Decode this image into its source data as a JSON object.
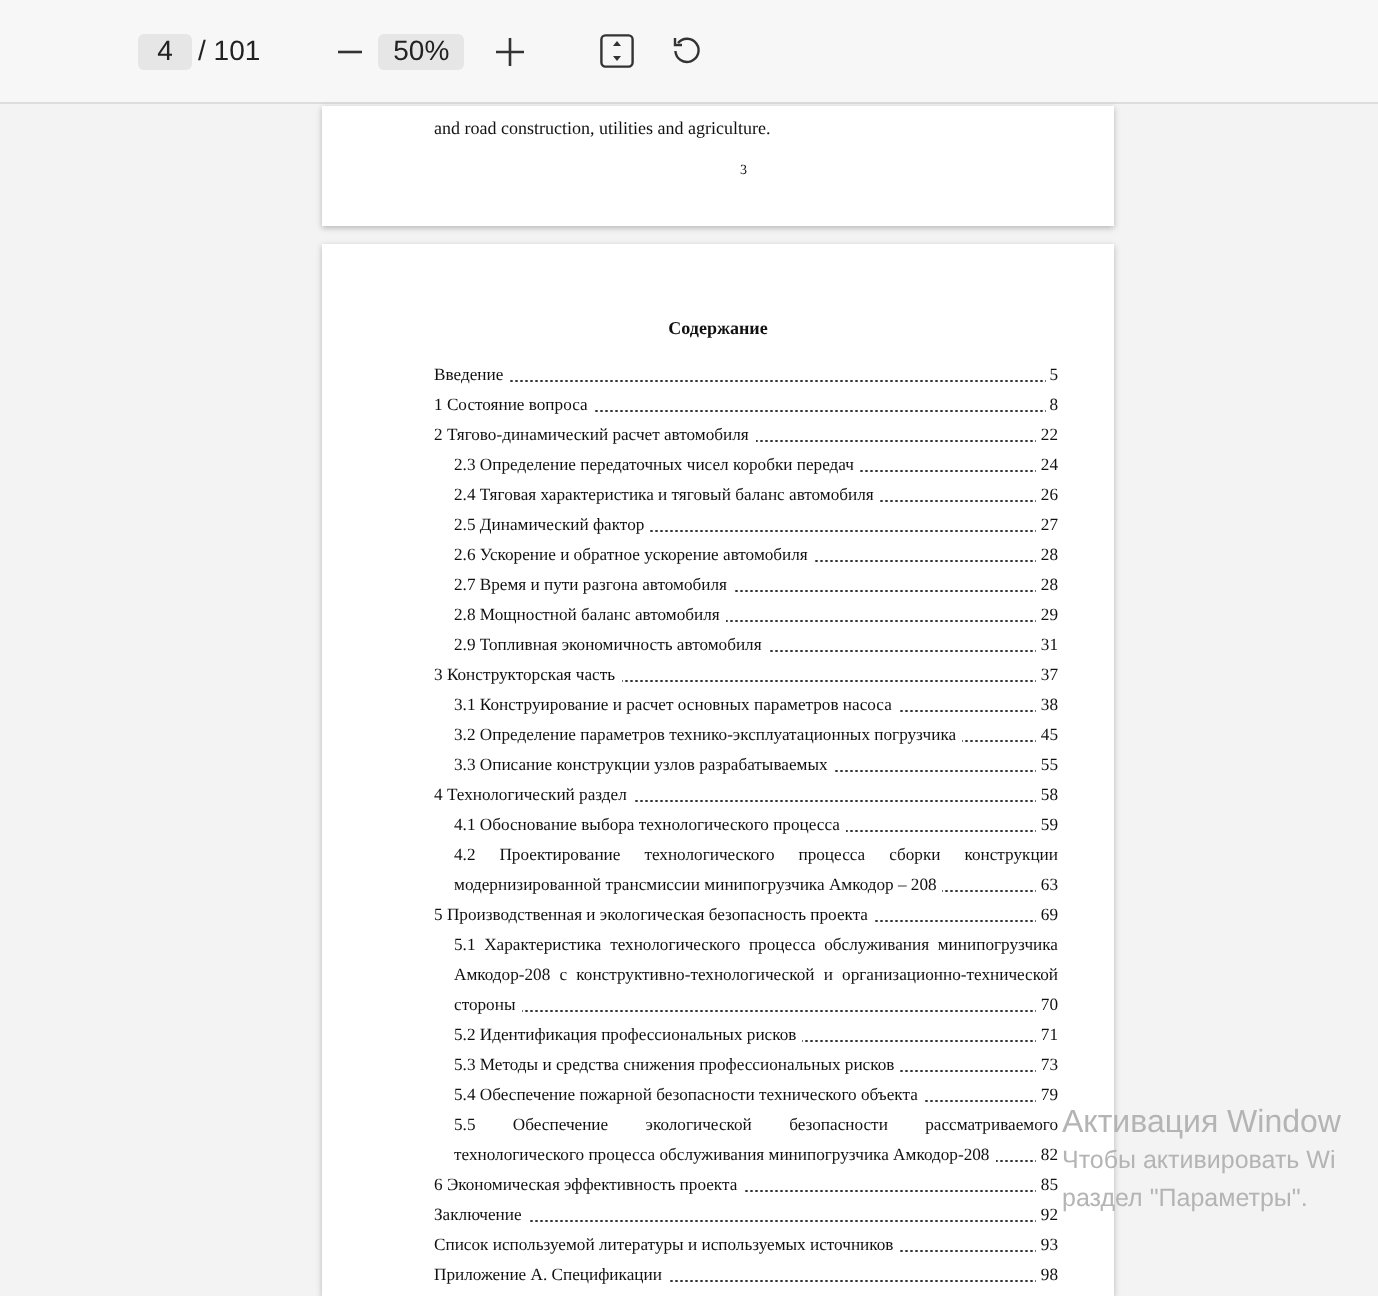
{
  "toolbar": {
    "page_input": "4",
    "page_total": "/ 101",
    "zoom": "50%"
  },
  "previous_page": {
    "text": "and road construction, utilities and agriculture.",
    "page_number": "3"
  },
  "toc": {
    "title": "Содержание",
    "entries": [
      {
        "text": "Введение",
        "page": "5"
      },
      {
        "text": "1 Состояние вопроса",
        "page": "8"
      },
      {
        "text": "2 Тягово-динамический расчет автомобиля",
        "page": "22",
        "children": [
          {
            "text": "2.3 Определение передаточных чисел коробки передач",
            "page": "24"
          },
          {
            "text": "2.4 Тяговая характеристика и тяговый баланс автомобиля",
            "page": "26"
          },
          {
            "text": "2.5 Динамический фактор",
            "page": "27"
          },
          {
            "text": "2.6 Ускорение и обратное ускорение автомобиля",
            "page": "28"
          },
          {
            "text": "2.7 Время и пути разгона автомобиля",
            "page": "28"
          },
          {
            "text": "2.8 Мощностной баланс автомобиля",
            "page": "29"
          },
          {
            "text": "2.9 Топливная экономичность автомобиля",
            "page": "31"
          }
        ]
      },
      {
        "text": "3 Конструкторская часть",
        "page": "37",
        "children": [
          {
            "text": "3.1 Конструирование и расчет основных параметров насоса",
            "page": "38"
          },
          {
            "text": "3.2 Определение параметров технико-эксплуатационных погрузчика",
            "page": "45"
          },
          {
            "text": "3.3 Описание конструкции узлов разрабатываемых",
            "page": "55"
          }
        ]
      },
      {
        "text": "4 Технологический раздел",
        "page": "58",
        "children": [
          {
            "text": "4.1 Обоснование выбора технологического процесса",
            "page": "59"
          },
          {
            "text": "4.2 Проектирование технологического процесса сборки конструкции модернизированной трансмиссии минипогрузчика Амкодор – 208",
            "page": "63"
          }
        ]
      },
      {
        "text": "5 Производственная и экологическая безопасность проекта",
        "page": "69",
        "children": [
          {
            "text": "5.1 Характеристика технологического процесса обслуживания минипогрузчика Амкодор-208 с конструктивно-технологической и организационно-технической стороны",
            "page": "70"
          },
          {
            "text": "5.2 Идентификация профессиональных рисков",
            "page": "71"
          },
          {
            "text": "5.3 Методы и средства снижения профессиональных рисков",
            "page": "73"
          },
          {
            "text": "5.4 Обеспечение пожарной безопасности технического объекта",
            "page": "79"
          },
          {
            "text": "5.5 Обеспечение экологической безопасности рассматриваемого технологического процесса обслуживания минипогрузчика Амкодор-208",
            "page": "82"
          }
        ]
      },
      {
        "text": "6 Экономическая эффективность проекта",
        "page": "85"
      },
      {
        "text": "Заключение",
        "page": "92"
      },
      {
        "text": "Список используемой литературы и используемых источников",
        "page": "93"
      },
      {
        "text": "Приложение А. Спецификации",
        "page": "98"
      }
    ]
  },
  "activation_notice": [
    "Активация Window",
    "Чтобы активировать Wi",
    "раздел \"Параметры\"."
  ]
}
